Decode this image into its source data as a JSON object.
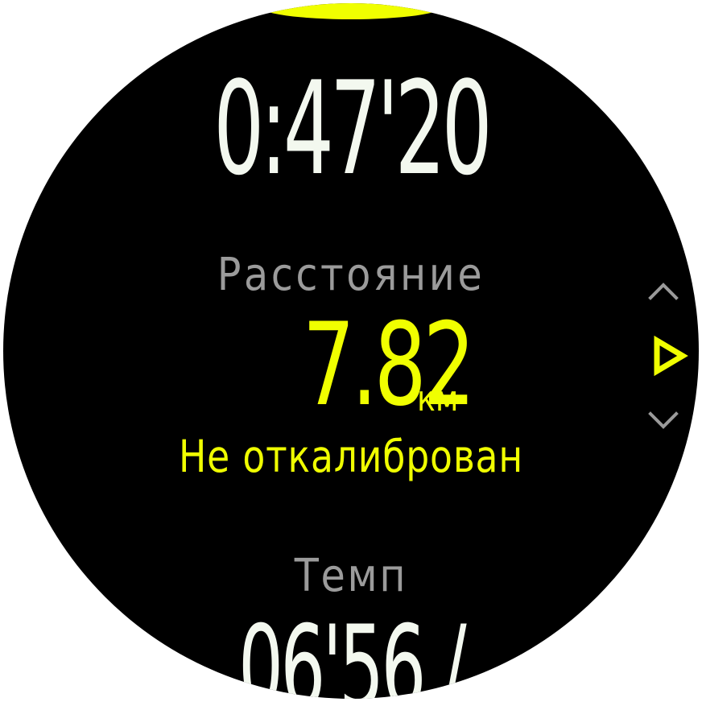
{
  "workout": {
    "duration": "0:47'20",
    "distance_label": "Расстояние",
    "distance_value": "7.82",
    "distance_unit": "км",
    "calibration_status": "Не откалиброван",
    "pace_label": "Темп",
    "pace_value": "06'56 /"
  },
  "navigation": {
    "up_icon": "chevron-up-icon",
    "play_icon": "play-triangle-icon",
    "down_icon": "chevron-down-icon"
  },
  "colors": {
    "background": "#000000",
    "accent": "#f0ff00",
    "primary_text": "#f3f8ef",
    "secondary_text": "#9b9b9b",
    "icon_gray": "#9a9a9a"
  }
}
